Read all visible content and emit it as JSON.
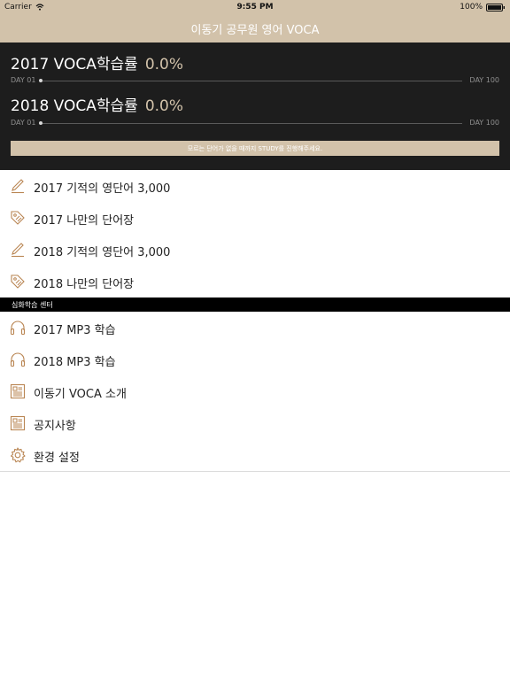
{
  "status_bar": {
    "carrier": "Carrier",
    "time": "9:55 PM",
    "battery": "100%"
  },
  "nav": {
    "title": "이동기 공무원 영어 VOCA"
  },
  "progress": [
    {
      "title": "2017 VOCA학습률",
      "percent": "0.0%",
      "start_label": "DAY 01",
      "end_label": "DAY 100",
      "value": 0.0
    },
    {
      "title": "2018 VOCA학습률",
      "percent": "0.0%",
      "start_label": "DAY 01",
      "end_label": "DAY 100",
      "value": 0.0
    }
  ],
  "study_button": "모르는 단어가 없을 때까지 STUDY를 진행해주세요.",
  "menu": [
    {
      "label": "2017 기적의 영단어 3,000",
      "icon": "pencil-icon"
    },
    {
      "label": "2017 나만의 단어장",
      "icon": "tag-icon"
    },
    {
      "label": "2018 기적의 영단어 3,000",
      "icon": "pencil-icon"
    },
    {
      "label": "2018 나만의 단어장",
      "icon": "tag-icon"
    }
  ],
  "section_header": "심화학습 센터",
  "menu2": [
    {
      "label": "2017 MP3 학습",
      "icon": "headphones-icon"
    },
    {
      "label": "2018 MP3 학습",
      "icon": "headphones-icon"
    },
    {
      "label": "이동기 VOCA 소개",
      "icon": "document-icon"
    },
    {
      "label": "공지사항",
      "icon": "document-icon"
    },
    {
      "label": "환경 설정",
      "icon": "gear-icon"
    }
  ],
  "colors": {
    "accent": "#d2c2aa",
    "icon": "#b98552",
    "dark": "#1d1d1d"
  }
}
